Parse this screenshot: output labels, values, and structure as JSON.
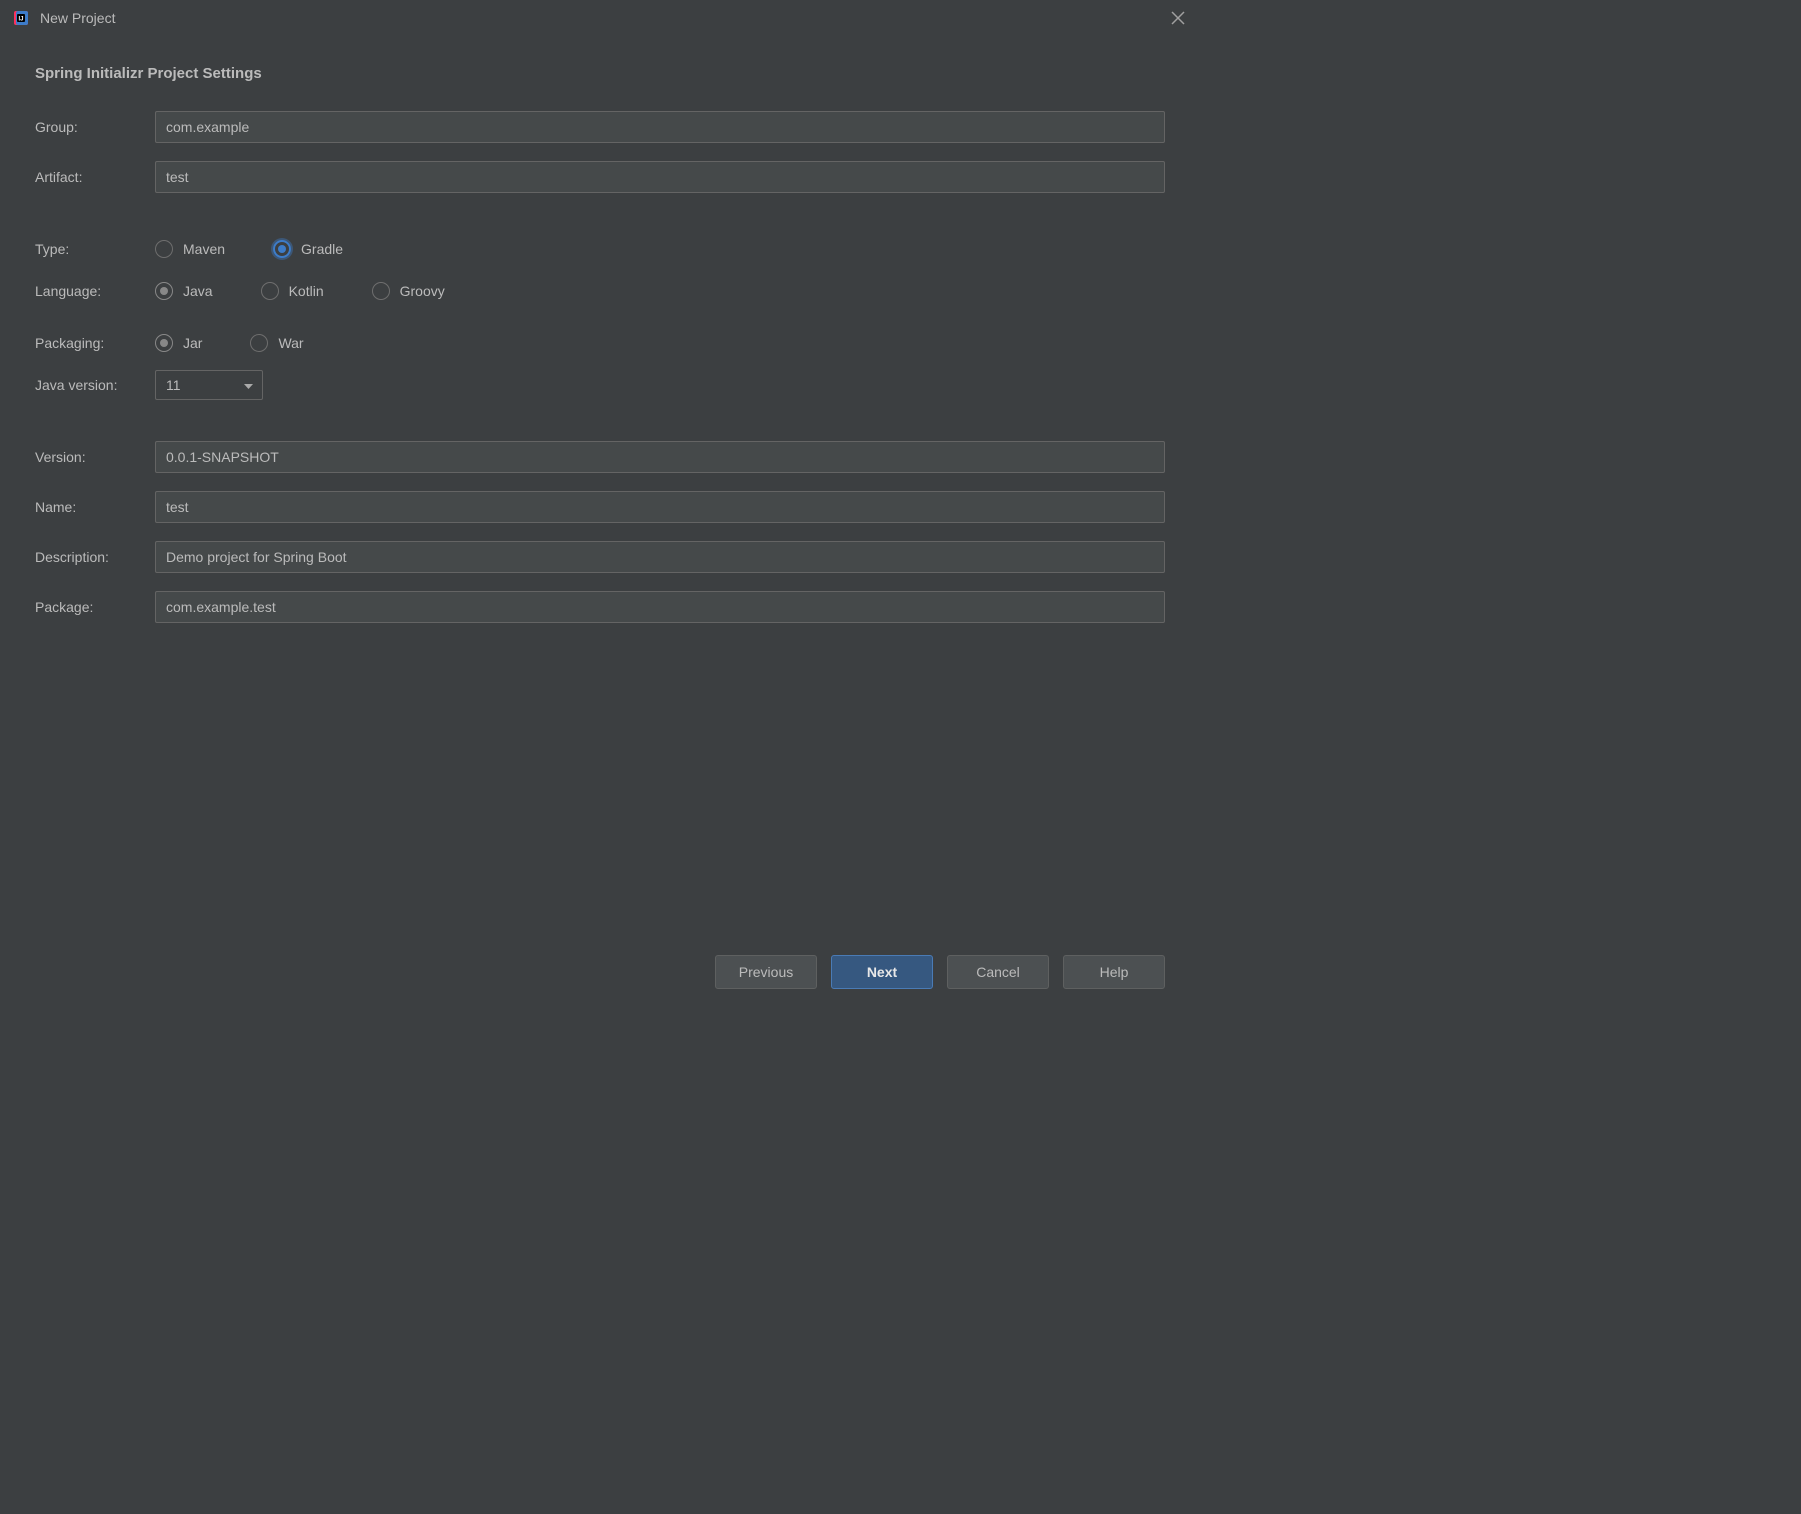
{
  "window": {
    "title": "New Project"
  },
  "heading": "Spring Initializr Project Settings",
  "labels": {
    "group": "Group:",
    "artifact": "Artifact:",
    "type": "Type:",
    "language": "Language:",
    "packaging": "Packaging:",
    "javaVersion": "Java version:",
    "version": "Version:",
    "name": "Name:",
    "description": "Description:",
    "package": "Package:"
  },
  "fields": {
    "group": "com.example",
    "artifact": "test",
    "version": "0.0.1-SNAPSHOT",
    "name": "test",
    "description": "Demo project for Spring Boot",
    "package": "com.example.test",
    "javaVersion": "11"
  },
  "radios": {
    "type": {
      "maven": "Maven",
      "gradle": "Gradle"
    },
    "language": {
      "java": "Java",
      "kotlin": "Kotlin",
      "groovy": "Groovy"
    },
    "packaging": {
      "jar": "Jar",
      "war": "War"
    }
  },
  "buttons": {
    "previous": "Previous",
    "next": "Next",
    "cancel": "Cancel",
    "help": "Help"
  }
}
